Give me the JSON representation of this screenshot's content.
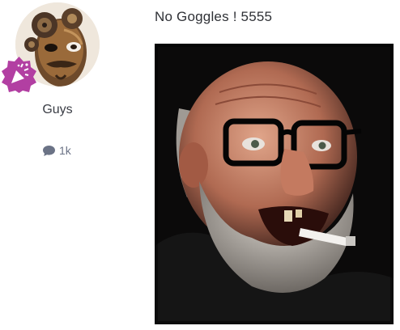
{
  "author": {
    "name": "Guys",
    "avatar_icon": "steampunk-mask-avatar",
    "badge_icon": "party-popper-icon",
    "badge_color": "#b23fa2"
  },
  "stats": {
    "comment_icon": "speech-bubble-icon",
    "comments": "1k",
    "icon_color": "#6b7386"
  },
  "post": {
    "title": "No Goggles ! 5555",
    "image_icon": "old-man-with-glasses-photo"
  }
}
